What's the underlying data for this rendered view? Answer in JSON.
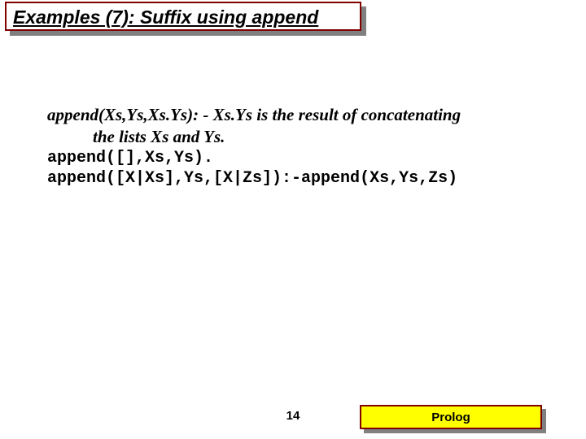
{
  "title": "Examples (7): Suffix using append",
  "spec_line1": "append(Xs,Ys,Xs.Ys): - Xs.Ys is the result of concatenating",
  "spec_line2": "the lists Xs and Ys.",
  "code_line1": "append([],Xs,Ys).",
  "code_line2": "append([X|Xs],Ys,[X|Zs]):-append(Xs,Ys,Zs)",
  "page_number": "14",
  "footer": "Prolog"
}
